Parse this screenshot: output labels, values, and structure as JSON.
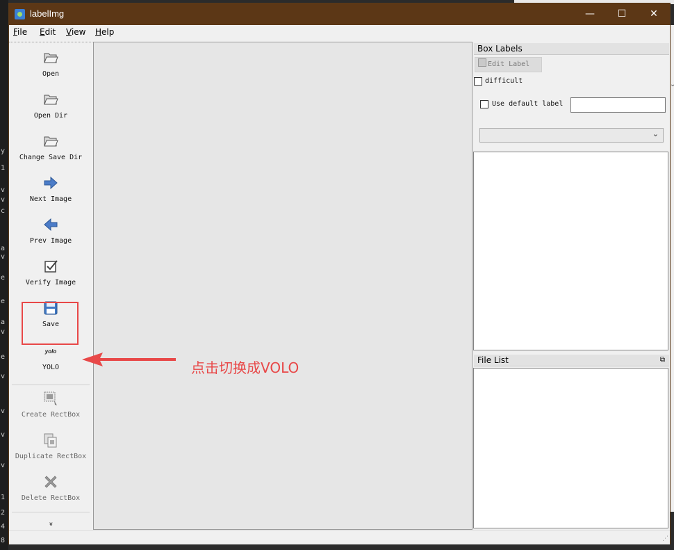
{
  "window": {
    "title": "labelImg",
    "controls": {
      "minimize": "—",
      "maximize": "☐",
      "close": "✕"
    }
  },
  "menubar": {
    "items": [
      {
        "underline": "F",
        "rest": "ile"
      },
      {
        "underline": "E",
        "rest": "dit"
      },
      {
        "underline": "V",
        "rest": "iew"
      },
      {
        "underline": "H",
        "rest": "elp"
      }
    ]
  },
  "toolbar": {
    "open": "Open",
    "open_dir": "Open Dir",
    "change_save_dir": "Change Save Dir",
    "next_image": "Next Image",
    "prev_image": "Prev Image",
    "verify_image": "Verify Image",
    "save": "Save",
    "format_icon_text": "yolo",
    "format": "YOLO",
    "create_rectbox": "Create RectBox",
    "duplicate_rectbox": "Duplicate RectBox",
    "delete_rectbox": "Delete RectBox",
    "more": "»"
  },
  "box_labels": {
    "title": "Box Labels",
    "edit_label": "Edit Label",
    "difficult": "difficult",
    "use_default_label": "Use default label",
    "default_label_value": ""
  },
  "file_list": {
    "title": "File List"
  },
  "annotation": {
    "text": "点击切换成VOLO",
    "color": "#e84848"
  },
  "colors": {
    "titlebar": "#5c3716",
    "annotation": "#e84848"
  }
}
